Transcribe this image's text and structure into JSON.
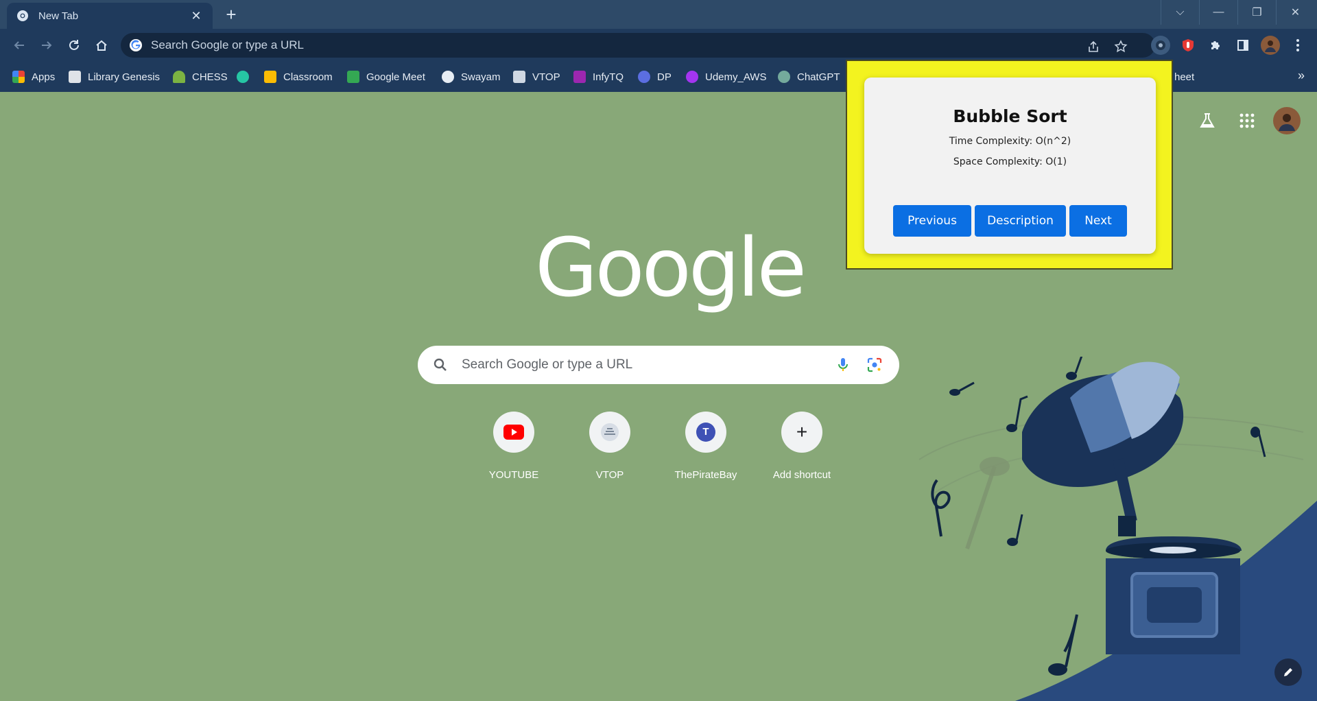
{
  "tab": {
    "title": "New Tab",
    "close": "✕"
  },
  "newtab": {
    "label": "+"
  },
  "window_controls": {
    "dropdown": "⌵",
    "minimize": "—",
    "restore": "❐",
    "close": "✕"
  },
  "omnibox": {
    "placeholder": "Search Google or type a URL"
  },
  "bookmarks": [
    {
      "label": "Apps",
      "color": "#4285f4"
    },
    {
      "label": "Library Genesis",
      "color": "#dfe3e8"
    },
    {
      "label": "CHESS",
      "color": "#7cb342"
    },
    {
      "label": "",
      "color": "#26c6a4"
    },
    {
      "label": "Classroom",
      "color": "#fbbc04"
    },
    {
      "label": "Google Meet",
      "color": "#34a853"
    },
    {
      "label": "Swayam",
      "color": "#e7edf4"
    },
    {
      "label": "VTOP",
      "color": "#cfd8e3"
    },
    {
      "label": "InfyTQ",
      "color": "#9c27b0"
    },
    {
      "label": "DP",
      "color": "#5b6ee1"
    },
    {
      "label": "Udemy_AWS",
      "color": "#a435f0"
    },
    {
      "label": "ChatGPT",
      "color": "#74aa9c"
    },
    {
      "label": "heet",
      "color": ""
    }
  ],
  "bookmarks_more": "»",
  "search": {
    "placeholder": "Search Google or type a URL"
  },
  "google_logo": "Google",
  "shortcuts": [
    {
      "label": "YOUTUBE",
      "icon": "youtube-icon"
    },
    {
      "label": "VTOP",
      "icon": "vtop-icon"
    },
    {
      "label": "ThePirateBay",
      "icon": "T"
    },
    {
      "label": "Add shortcut",
      "icon": "+"
    }
  ],
  "popup": {
    "title": "Bubble Sort",
    "time": "Time Complexity: O(n^2)",
    "space": "Space Complexity: O(1)",
    "prev": "Previous",
    "desc": "Description",
    "next": "Next"
  },
  "colors": {
    "accent_button": "#0b6fe3",
    "popup_bg": "#f3f31f",
    "page_bg": "#88a878",
    "chrome_dark": "#1f3a5c"
  }
}
